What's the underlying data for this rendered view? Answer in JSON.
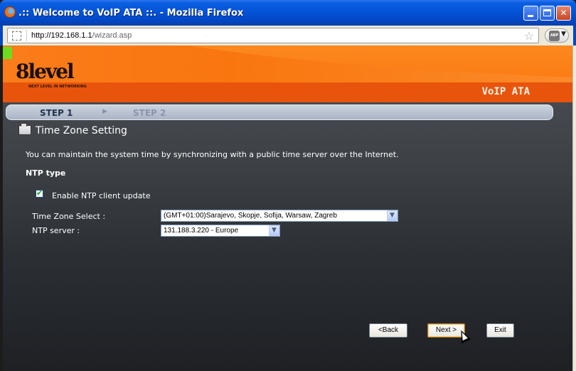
{
  "window": {
    "title": ".:: Welcome to VoIP ATA ::. - Mozilla Firefox"
  },
  "browser": {
    "url_host": "http://192.168.1.1",
    "url_path": "/wizard.asp",
    "bookmark_icon": "star-icon",
    "addon_label": "ABP"
  },
  "header": {
    "logo_text": "8level",
    "tagline": "NEXT LEVEL IN NETWORKING",
    "product": "VoIP ATA"
  },
  "steps": {
    "step1": "STEP 1",
    "step2": "STEP 2"
  },
  "section": {
    "title": "Time Zone Setting",
    "description": "You can maintain the system time by synchronizing with a public time server over the Internet.",
    "ntp_type_label": "NTP type"
  },
  "form": {
    "enable_ntp_label": "Enable NTP client update",
    "enable_ntp_checked": true,
    "timezone_label": "Time Zone Select :",
    "timezone_value": "(GMT+01:00)Sarajevo, Skopje, Sofija, Warsaw, Zagreb",
    "ntp_server_label": "NTP server :",
    "ntp_server_value": "131.188.3.220 - Europe"
  },
  "buttons": {
    "back": "<Back",
    "next": "Next >",
    "exit": "Exit"
  },
  "colors": {
    "accent_orange": "#f9760f",
    "titlebar_blue": "#0454d8"
  }
}
